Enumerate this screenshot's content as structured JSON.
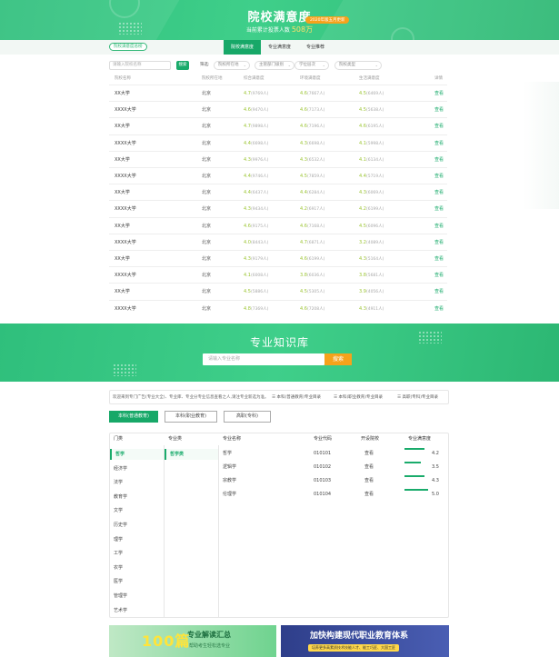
{
  "hero": {
    "title": "院校满意度",
    "badge": "2020年版五月更新",
    "subtitle_prefix": "当前累计投票人数",
    "vote_count": "508万"
  },
  "tabs": {
    "left_pill": "院校满意度总榜",
    "items": [
      {
        "label": "院校满意度",
        "active": true
      },
      {
        "label": "专业满意度",
        "active": false
      },
      {
        "label": "专业推荐",
        "active": false
      }
    ]
  },
  "filters": {
    "search_placeholder": "请输入院校名称",
    "search_button": "搜索",
    "filter_label": "筛选:",
    "selects": [
      "院校所在地",
      "主管部门级别",
      "学位层次",
      "院校类型"
    ]
  },
  "table": {
    "headers": [
      "院校名称",
      "院校所在地",
      "综合满意度",
      "环境满意度",
      "生活满意度",
      "详情"
    ],
    "rows": [
      {
        "name": "XX大学",
        "location": "北京",
        "s1": "4.7",
        "n1": "(9769人)",
        "s2": "4.6",
        "n2": "(7667人)",
        "s3": "4.5",
        "n3": "(6469人)",
        "view": "查看"
      },
      {
        "name": "XXXX大学",
        "location": "北京",
        "s1": "4.6",
        "n1": "(9470人)",
        "s2": "4.6",
        "n2": "(7173人)",
        "s3": "4.5",
        "n3": "(5638人)",
        "view": "查看"
      },
      {
        "name": "XX大学",
        "location": "北京",
        "s1": "4.7",
        "n1": "(9898人)",
        "s2": "4.6",
        "n2": "(7196人)",
        "s3": "4.6",
        "n3": "(6195人)",
        "view": "查看"
      },
      {
        "name": "XXXX大学",
        "location": "北京",
        "s1": "4.4",
        "n1": "(6698人)",
        "s2": "4.3",
        "n2": "(6698人)",
        "s3": "4.1",
        "n3": "(5998人)",
        "view": "查看"
      },
      {
        "name": "XX大学",
        "location": "北京",
        "s1": "4.3",
        "n1": "(9976人)",
        "s2": "4.3",
        "n2": "(6532人)",
        "s3": "4.1",
        "n3": "(6134人)",
        "view": "查看"
      },
      {
        "name": "XXXX大学",
        "location": "北京",
        "s1": "4.4",
        "n1": "(9746人)",
        "s2": "4.5",
        "n2": "(7859人)",
        "s3": "4.4",
        "n3": "(5719人)",
        "view": "查看"
      },
      {
        "name": "XX大学",
        "location": "北京",
        "s1": "4.4",
        "n1": "(6437人)",
        "s2": "4.4",
        "n2": "(6284人)",
        "s3": "4.3",
        "n3": "(6069人)",
        "view": "查看"
      },
      {
        "name": "XXXX大学",
        "location": "北京",
        "s1": "4.3",
        "n1": "(9434人)",
        "s2": "4.2",
        "n2": "(6917人)",
        "s3": "4.2",
        "n3": "(6199人)",
        "view": "查看"
      },
      {
        "name": "XX大学",
        "location": "北京",
        "s1": "4.6",
        "n1": "(9175人)",
        "s2": "4.6",
        "n2": "(7168人)",
        "s3": "4.5",
        "n3": "(6096人)",
        "view": "查看"
      },
      {
        "name": "XXXX大学",
        "location": "北京",
        "s1": "4.0",
        "n1": "(8443人)",
        "s2": "4.7",
        "n2": "(6871人)",
        "s3": "3.2",
        "n3": "(4089人)",
        "view": "查看"
      },
      {
        "name": "XX大学",
        "location": "北京",
        "s1": "4.3",
        "n1": "(9179人)",
        "s2": "4.6",
        "n2": "(6199人)",
        "s3": "4.3",
        "n3": "(5164人)",
        "view": "查看"
      },
      {
        "name": "XXXX大学",
        "location": "北京",
        "s1": "4.1",
        "n1": "(6008人)",
        "s2": "3.8",
        "n2": "(6036人)",
        "s3": "3.8",
        "n3": "(5681人)",
        "view": "查看"
      },
      {
        "name": "XX大学",
        "location": "北京",
        "s1": "4.5",
        "n1": "(5886人)",
        "s2": "4.5",
        "n2": "(5305人)",
        "s3": "3.9",
        "n3": "(4056人)",
        "view": "查看"
      },
      {
        "name": "XXXX大学",
        "location": "北京",
        "s1": "4.8",
        "n1": "(7369人)",
        "s2": "4.6",
        "n2": "(7208人)",
        "s3": "4.3",
        "n3": "(4911人)",
        "view": "查看"
      }
    ]
  },
  "knowledge": {
    "title": "专业知识库",
    "search_placeholder": "请输入专业名称",
    "search_button": "搜索",
    "notice": "欢迎来到专门广告(专业大全)、专业库、专业分专业信息查看之人,请注专业新选为准。",
    "links": [
      "本科(普通教育)专业目录",
      "本科(职业教育)专业目录",
      "高职(专科)专业目录"
    ],
    "level_tabs": [
      {
        "label": "本科(普通教育)",
        "active": true
      },
      {
        "label": "本科(职业教育)",
        "active": false
      },
      {
        "label": "高职(专科)",
        "active": false
      }
    ],
    "panel_headers": [
      "门类",
      "专业类",
      "专业名称",
      "专业代码",
      "开设院校",
      "专业满意度"
    ],
    "categories": [
      "哲学",
      "经济学",
      "法学",
      "教育学",
      "文学",
      "历史学",
      "理学",
      "工学",
      "农学",
      "医学",
      "管理学",
      "艺术学"
    ],
    "subcategory": "哲学类",
    "majors": [
      {
        "name": "哲学",
        "code": "010101",
        "school": "查看",
        "score": "4.2",
        "ratio": 0.84
      },
      {
        "name": "逻辑学",
        "code": "010102",
        "school": "查看",
        "score": "3.5",
        "ratio": 0.7
      },
      {
        "name": "宗教学",
        "code": "010103",
        "school": "查看",
        "score": "4.3",
        "ratio": 0.86
      },
      {
        "name": "伦理学",
        "code": "010104",
        "school": "查看",
        "score": "5.0",
        "ratio": 1.0
      }
    ]
  },
  "banners": {
    "b1_big": "100篇",
    "b1_title": "专业解读汇总",
    "b1_sub": "帮助考生轻松选专业",
    "b2_title": "加快构建现代职业教育体系",
    "b2_sub": "培养更多高素质技术技能人才、能工巧匠、大国工匠"
  }
}
